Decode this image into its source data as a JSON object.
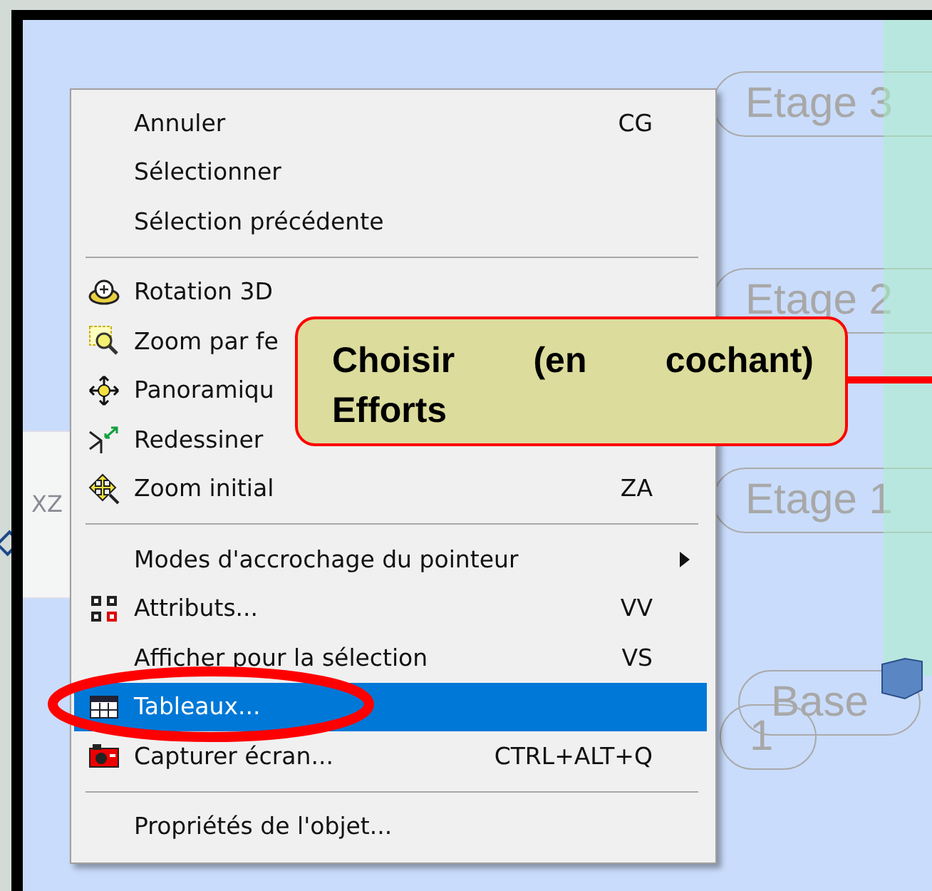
{
  "canvas": {
    "axis_label": "XZ",
    "levels": [
      {
        "label": "Etage 3"
      },
      {
        "label": "Etage 2"
      },
      {
        "label": "Etage 1"
      },
      {
        "label": "Base"
      },
      {
        "label": "1"
      }
    ]
  },
  "context_menu": {
    "items": [
      {
        "kind": "item",
        "label": "Annuler",
        "shortcut": "CG",
        "selected": false
      },
      {
        "kind": "item",
        "label": "Sélectionner",
        "selected": false
      },
      {
        "kind": "item",
        "label": "Sélection précédente",
        "selected": false
      },
      {
        "kind": "separator"
      },
      {
        "kind": "item",
        "label": "Rotation 3D",
        "selected": false
      },
      {
        "kind": "item",
        "label": "Zoom par fe",
        "selected": false
      },
      {
        "kind": "item",
        "label": "Panoramiqu",
        "selected": false
      },
      {
        "kind": "item",
        "label": "Redessiner",
        "selected": false
      },
      {
        "kind": "item",
        "label": "Zoom initial",
        "shortcut": "ZA",
        "selected": false
      },
      {
        "kind": "separator"
      },
      {
        "kind": "item",
        "label": "Modes d'accrochage du pointeur",
        "submenu": true,
        "selected": false
      },
      {
        "kind": "item",
        "label": "Attributs...",
        "shortcut": "VV",
        "selected": false
      },
      {
        "kind": "item",
        "label": "Afficher pour la sélection",
        "shortcut": "VS",
        "selected": false
      },
      {
        "kind": "item",
        "label": "Tableaux...",
        "selected": true
      },
      {
        "kind": "item",
        "label": "Capturer écran...",
        "shortcut": "CTRL+ALT+Q",
        "selected": false
      },
      {
        "kind": "separator"
      },
      {
        "kind": "item",
        "label": "Propriétés de l'objet...",
        "selected": false
      }
    ]
  },
  "callout": {
    "text": "Choisir (en cochant) Efforts"
  }
}
